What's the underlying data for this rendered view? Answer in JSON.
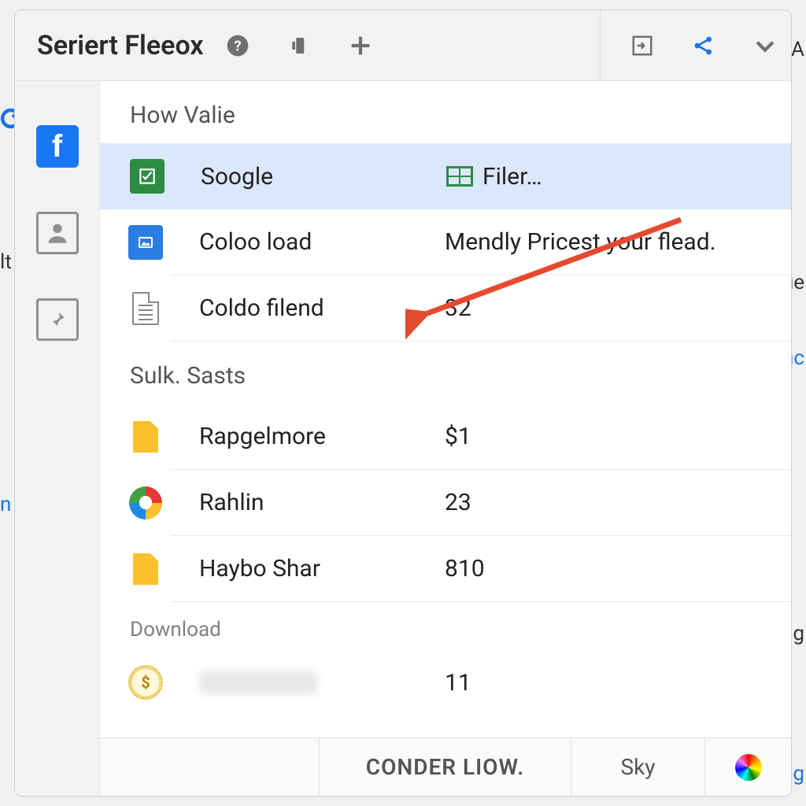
{
  "header": {
    "title": "Seriert Fleeox"
  },
  "sections": [
    {
      "title": "How Valie",
      "rows": [
        {
          "label": "Soogle",
          "value": "Filer…",
          "selected": true,
          "icon": "green-check"
        },
        {
          "label": "Coloo load",
          "value": "Mendly Pricest your flead.",
          "icon": "blue-photo"
        },
        {
          "label": "Coldo filend",
          "value": "32",
          "icon": "document"
        }
      ]
    },
    {
      "title": "Sulk. Sasts",
      "rows": [
        {
          "label": "Rapgelmore",
          "value": "$1",
          "icon": "yellow-file"
        },
        {
          "label": "Rahlin",
          "value": "23",
          "icon": "color-circle"
        },
        {
          "label": "Haybo Shar",
          "value": "810",
          "icon": "yellow-file"
        }
      ]
    },
    {
      "title": "Download",
      "small": true,
      "rows": [
        {
          "label": "",
          "value": "11",
          "icon": "coin",
          "blurred": true
        }
      ]
    }
  ],
  "footer": {
    "button_primary": "CONDER LIOW.",
    "button_secondary": "Sky"
  },
  "peek": {
    "r1": "A",
    "r3": "ue",
    "r4": "nc",
    "r6": "vig",
    "r7": "ng",
    "l1": "lt",
    "l2": "n"
  }
}
